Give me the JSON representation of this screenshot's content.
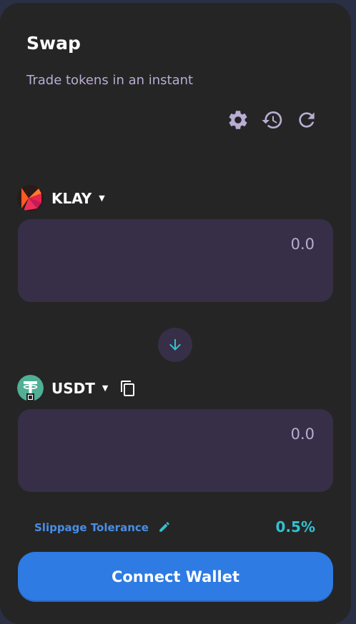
{
  "swap": {
    "title": "Swap",
    "subtitle": "Trade tokens in an instant"
  },
  "toolbar": {
    "settings_icon": "gear-icon",
    "history_icon": "history-icon",
    "refresh_icon": "refresh-icon"
  },
  "from_token": {
    "symbol": "KLAY",
    "amount_placeholder": "0.0"
  },
  "to_token": {
    "symbol": "USDT",
    "amount_placeholder": "0.0"
  },
  "slippage": {
    "label": "Slippage Tolerance",
    "value": "0.5%"
  },
  "connect_button": {
    "label": "Connect Wallet"
  },
  "colors": {
    "background": "#2a2f44",
    "card": "#252525",
    "input": "#372f47",
    "accent_blue": "#2e7be3",
    "accent_teal": "#32c1d0",
    "muted_text": "#b8add2"
  }
}
